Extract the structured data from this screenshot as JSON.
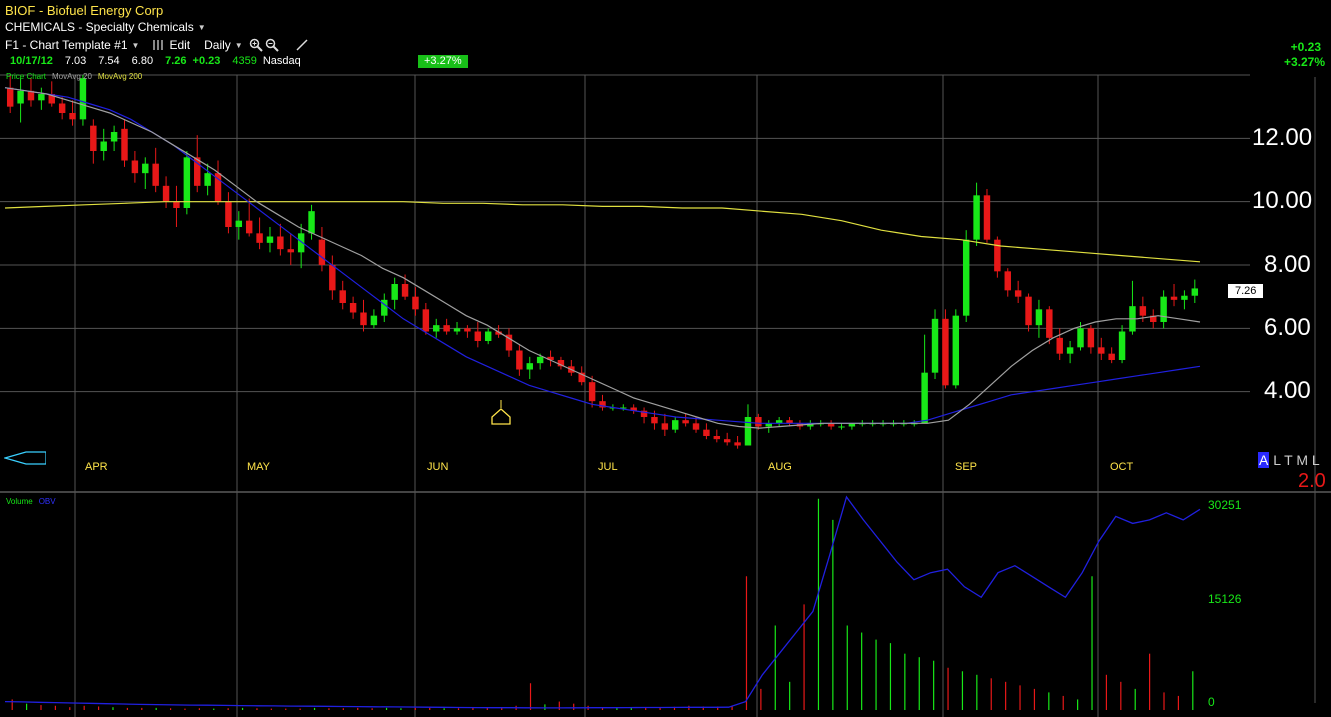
{
  "header": {
    "title": "BIOF - Biofuel Energy Corp",
    "sector": "CHEMICALS - Specialty Chemicals",
    "template": "F1 - Chart Template #1",
    "edit_label": "Edit",
    "period_label": "Daily"
  },
  "quote": {
    "date": "10/17/12",
    "open": "7.03",
    "high": "7.54",
    "low": "6.80",
    "close": "7.26",
    "change": "+0.23",
    "volume": "4359",
    "exchange": "Nasdaq",
    "pct_badge": "+3.27%",
    "right_change": "+0.23",
    "right_pct": "+3.27%"
  },
  "legend": {
    "price_chart": "Price Chart",
    "movavg20": "MovAvg 20",
    "movavg200": "MovAvg 200",
    "volume": "Volume",
    "obv": "OBV"
  },
  "price_axis": [
    "12.00",
    "10.00",
    "8.00",
    "6.00",
    "4.00"
  ],
  "last_price_label": "7.26",
  "months": [
    "APR",
    "MAY",
    "JUN",
    "JUL",
    "AUG",
    "SEP",
    "OCT"
  ],
  "volume_axis": [
    "30251",
    "15126",
    "0"
  ],
  "corner": {
    "letters": "ALTML",
    "value": "2.0"
  },
  "colors": {
    "up": "#18e818",
    "down": "#e81818",
    "ma50": "#2020e0",
    "ma20": "#a0a0a0",
    "ma200": "#e0e040",
    "grid": "#555555"
  },
  "chart_data": {
    "type": "candlestick",
    "ylim": [
      2,
      14
    ],
    "candles": [
      [
        13.6,
        14.0,
        12.8,
        13.0
      ],
      [
        13.1,
        13.9,
        12.5,
        13.5
      ],
      [
        13.5,
        13.9,
        13.0,
        13.2
      ],
      [
        13.2,
        13.6,
        12.9,
        13.4
      ],
      [
        13.4,
        13.8,
        13.0,
        13.1
      ],
      [
        13.1,
        13.3,
        12.6,
        12.8
      ],
      [
        12.8,
        13.2,
        12.4,
        12.6
      ],
      [
        12.6,
        14.0,
        12.4,
        13.9
      ],
      [
        12.4,
        12.6,
        11.2,
        11.6
      ],
      [
        11.6,
        12.3,
        11.3,
        11.9
      ],
      [
        11.9,
        12.4,
        11.6,
        12.2
      ],
      [
        12.3,
        12.6,
        11.1,
        11.3
      ],
      [
        11.3,
        11.6,
        10.6,
        10.9
      ],
      [
        10.9,
        11.4,
        10.4,
        11.2
      ],
      [
        11.2,
        11.7,
        10.3,
        10.5
      ],
      [
        10.5,
        10.8,
        9.8,
        10.0
      ],
      [
        10.0,
        10.5,
        9.2,
        9.8
      ],
      [
        9.8,
        11.6,
        9.6,
        11.4
      ],
      [
        11.4,
        12.1,
        10.3,
        10.5
      ],
      [
        10.5,
        11.2,
        10.2,
        10.9
      ],
      [
        10.9,
        11.3,
        9.9,
        10.0
      ],
      [
        10.0,
        10.3,
        9.0,
        9.2
      ],
      [
        9.2,
        9.7,
        8.8,
        9.4
      ],
      [
        9.4,
        10.1,
        8.9,
        9.0
      ],
      [
        9.0,
        9.5,
        8.5,
        8.7
      ],
      [
        8.7,
        9.2,
        8.4,
        8.9
      ],
      [
        8.9,
        9.3,
        8.3,
        8.5
      ],
      [
        8.5,
        9.0,
        8.0,
        8.4
      ],
      [
        8.4,
        9.3,
        7.9,
        9.0
      ],
      [
        9.0,
        9.9,
        8.8,
        9.7
      ],
      [
        8.8,
        9.2,
        7.8,
        8.0
      ],
      [
        8.0,
        8.3,
        6.9,
        7.2
      ],
      [
        7.2,
        7.5,
        6.6,
        6.8
      ],
      [
        6.8,
        7.0,
        6.3,
        6.5
      ],
      [
        6.5,
        6.9,
        5.9,
        6.1
      ],
      [
        6.1,
        6.6,
        6.0,
        6.4
      ],
      [
        6.4,
        7.1,
        6.2,
        6.9
      ],
      [
        6.9,
        7.6,
        6.6,
        7.4
      ],
      [
        7.4,
        7.7,
        6.9,
        7.0
      ],
      [
        7.0,
        7.3,
        6.4,
        6.6
      ],
      [
        6.6,
        6.8,
        5.8,
        5.9
      ],
      [
        5.9,
        6.3,
        5.7,
        6.1
      ],
      [
        6.1,
        6.3,
        5.8,
        5.9
      ],
      [
        5.9,
        6.2,
        5.8,
        6.0
      ],
      [
        6.0,
        6.1,
        5.7,
        5.9
      ],
      [
        5.9,
        6.2,
        5.4,
        5.6
      ],
      [
        5.6,
        6.0,
        5.5,
        5.9
      ],
      [
        5.9,
        6.1,
        5.7,
        5.8
      ],
      [
        5.8,
        6.0,
        5.1,
        5.3
      ],
      [
        5.3,
        5.5,
        4.5,
        4.7
      ],
      [
        4.7,
        5.1,
        4.4,
        4.9
      ],
      [
        4.9,
        5.2,
        4.7,
        5.1
      ],
      [
        5.1,
        5.3,
        4.8,
        5.0
      ],
      [
        5.0,
        5.1,
        4.7,
        4.8
      ],
      [
        4.8,
        5.0,
        4.5,
        4.6
      ],
      [
        4.6,
        4.8,
        4.2,
        4.3
      ],
      [
        4.3,
        4.5,
        3.5,
        3.7
      ],
      [
        3.7,
        3.9,
        3.4,
        3.5
      ],
      [
        3.5,
        3.6,
        3.4,
        3.5
      ],
      [
        3.5,
        3.6,
        3.4,
        3.5
      ],
      [
        3.5,
        3.6,
        3.3,
        3.4
      ],
      [
        3.4,
        3.5,
        3.0,
        3.2
      ],
      [
        3.2,
        3.4,
        2.8,
        3.0
      ],
      [
        3.0,
        3.3,
        2.6,
        2.8
      ],
      [
        2.8,
        3.2,
        2.7,
        3.1
      ],
      [
        3.1,
        3.3,
        2.9,
        3.0
      ],
      [
        3.0,
        3.2,
        2.7,
        2.8
      ],
      [
        2.8,
        3.0,
        2.5,
        2.6
      ],
      [
        2.6,
        2.8,
        2.4,
        2.5
      ],
      [
        2.5,
        2.7,
        2.3,
        2.4
      ],
      [
        2.4,
        2.6,
        2.2,
        2.3
      ],
      [
        2.3,
        3.6,
        2.3,
        3.2
      ],
      [
        3.2,
        3.3,
        2.8,
        2.9
      ],
      [
        2.9,
        3.1,
        2.7,
        3.0
      ],
      [
        3.0,
        3.2,
        2.9,
        3.1
      ],
      [
        3.1,
        3.2,
        2.9,
        3.0
      ],
      [
        3.0,
        3.1,
        2.8,
        2.9
      ],
      [
        2.9,
        3.1,
        2.8,
        3.0
      ],
      [
        3.0,
        3.1,
        2.9,
        3.0
      ],
      [
        3.0,
        3.1,
        2.8,
        2.9
      ],
      [
        2.9,
        3.0,
        2.8,
        2.9
      ],
      [
        2.9,
        3.0,
        2.8,
        3.0
      ],
      [
        3.0,
        3.1,
        2.9,
        3.0
      ],
      [
        3.0,
        3.1,
        2.9,
        3.0
      ],
      [
        3.0,
        3.1,
        2.9,
        3.0
      ],
      [
        3.0,
        3.1,
        2.9,
        3.0
      ],
      [
        3.0,
        3.1,
        2.9,
        3.0
      ],
      [
        3.0,
        3.1,
        2.9,
        3.0
      ],
      [
        3.0,
        5.8,
        3.0,
        4.6
      ],
      [
        4.6,
        6.6,
        4.4,
        6.3
      ],
      [
        6.3,
        6.6,
        4.1,
        4.2
      ],
      [
        4.2,
        6.6,
        4.1,
        6.4
      ],
      [
        6.4,
        9.1,
        6.2,
        8.8
      ],
      [
        8.8,
        10.6,
        8.6,
        10.2
      ],
      [
        10.2,
        10.4,
        8.7,
        8.8
      ],
      [
        8.8,
        8.9,
        7.6,
        7.8
      ],
      [
        7.8,
        7.9,
        7.0,
        7.2
      ],
      [
        7.2,
        7.5,
        6.8,
        7.0
      ],
      [
        7.0,
        7.1,
        5.9,
        6.1
      ],
      [
        6.1,
        6.9,
        5.7,
        6.6
      ],
      [
        6.6,
        6.7,
        5.5,
        5.7
      ],
      [
        5.7,
        6.0,
        5.0,
        5.2
      ],
      [
        5.2,
        5.6,
        4.9,
        5.4
      ],
      [
        5.4,
        6.2,
        5.3,
        6.0
      ],
      [
        6.0,
        6.1,
        5.2,
        5.4
      ],
      [
        5.4,
        5.7,
        5.0,
        5.2
      ],
      [
        5.2,
        5.4,
        4.9,
        5.0
      ],
      [
        5.0,
        6.1,
        4.9,
        5.9
      ],
      [
        5.9,
        7.5,
        5.8,
        6.7
      ],
      [
        6.7,
        7.0,
        6.2,
        6.4
      ],
      [
        6.4,
        6.6,
        6.0,
        6.2
      ],
      [
        6.2,
        7.2,
        6.0,
        7.0
      ],
      [
        7.0,
        7.4,
        6.7,
        6.9
      ],
      [
        6.9,
        7.2,
        6.6,
        7.03
      ],
      [
        7.03,
        7.54,
        6.8,
        7.26
      ]
    ],
    "ma20": [
      13.6,
      13.5,
      13.4,
      13.2,
      13.0,
      12.8,
      12.5,
      12.2,
      11.8,
      11.4,
      11.0,
      10.5,
      10.0,
      9.6,
      9.2,
      8.9,
      8.6,
      8.3,
      7.9,
      7.6,
      7.2,
      6.8,
      6.4,
      6.1,
      5.7,
      5.3,
      5.0,
      4.7,
      4.4,
      4.1,
      3.8,
      3.6,
      3.4,
      3.2,
      3.0,
      2.9,
      2.85,
      2.9,
      2.95,
      3.0,
      3.0,
      3.0,
      3.0,
      3.0,
      3.0,
      3.1,
      3.6,
      4.2,
      4.8,
      5.3,
      5.7,
      6.0,
      6.2,
      6.3,
      6.3,
      6.4,
      6.3,
      6.2
    ],
    "ma50": [
      13.6,
      13.5,
      13.4,
      13.3,
      13.1,
      12.9,
      12.6,
      12.2,
      11.8,
      11.3,
      10.8,
      10.3,
      9.8,
      9.3,
      8.8,
      8.3,
      7.8,
      7.3,
      6.8,
      6.3,
      5.9,
      5.5,
      5.1,
      4.8,
      4.5,
      4.2,
      4.0,
      3.8,
      3.6,
      3.5,
      3.4,
      3.3,
      3.2,
      3.15,
      3.1,
      3.05,
      3.0,
      3.0,
      3.0,
      3.0,
      3.0,
      3.0,
      3.0,
      3.0,
      3.1,
      3.3,
      3.5,
      3.7,
      3.9,
      4.0,
      4.1,
      4.2,
      4.3,
      4.4,
      4.5,
      4.6,
      4.7,
      4.8
    ],
    "ma200": [
      9.8,
      9.85,
      9.9,
      9.95,
      10.0,
      10.0,
      10.0,
      10.0,
      10.0,
      10.0,
      10.0,
      9.95,
      9.95,
      9.9,
      9.9,
      9.85,
      9.85,
      9.8,
      9.8,
      9.7,
      9.6,
      9.4,
      9.1,
      8.9,
      8.8,
      8.6,
      8.5,
      8.4,
      8.3,
      8.2,
      8.1
    ],
    "volume": [
      1500,
      900,
      700,
      600,
      400,
      600,
      500,
      400,
      300,
      300,
      300,
      250,
      200,
      250,
      200,
      250,
      300,
      250,
      200,
      200,
      200,
      300,
      250,
      250,
      300,
      250,
      300,
      250,
      300,
      300,
      250,
      250,
      300,
      350,
      400,
      600,
      3800,
      800,
      1200,
      900,
      600,
      400,
      400,
      300,
      300,
      300,
      450,
      600,
      500,
      500,
      500,
      19000,
      3000,
      12000,
      4000,
      15000,
      30000,
      27000,
      12000,
      11000,
      10000,
      9500,
      8000,
      7500,
      7000,
      6000,
      5500,
      5000,
      4500,
      4000,
      3500,
      3000,
      2500,
      2000,
      1500,
      19000,
      5000,
      4000,
      3000,
      8000,
      2500,
      2000,
      5500
    ],
    "obv": [
      1200,
      1150,
      1100,
      1050,
      1000,
      950,
      900,
      850,
      800,
      760,
      720,
      700,
      680,
      650,
      620,
      600,
      580,
      560,
      540,
      520,
      500,
      480,
      460,
      440,
      420,
      400,
      380,
      360,
      340,
      330,
      320,
      310,
      300,
      300,
      310,
      320,
      330,
      340,
      350,
      360,
      370,
      380,
      390,
      400,
      1200,
      5000,
      8000,
      11000,
      14000,
      22000,
      30251,
      27000,
      24000,
      21000,
      18500,
      19500,
      20000,
      17500,
      16000,
      19500,
      20500,
      19000,
      17500,
      16000,
      19500,
      24000,
      27500,
      26500,
      27000,
      28000,
      27000,
      28500
    ]
  }
}
